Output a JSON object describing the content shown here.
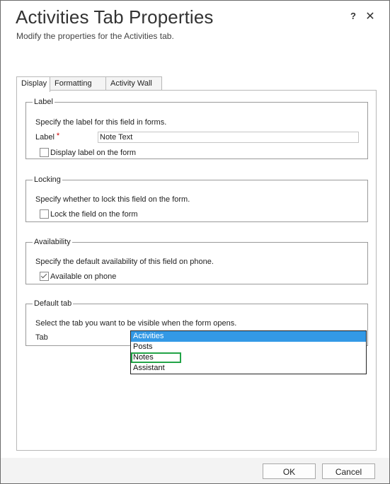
{
  "dialog": {
    "title": "Activities Tab Properties",
    "subtitle": "Modify the properties for the Activities tab.",
    "help_label": "?",
    "close_label": "✕"
  },
  "tabs": [
    {
      "label": "Display",
      "active": true
    },
    {
      "label": "Formatting",
      "active": false
    },
    {
      "label": "Activity Wall",
      "active": false
    }
  ],
  "label_section": {
    "legend": "Label",
    "description": "Specify the label for this field in forms.",
    "field_label": "Label",
    "required_marker": "*",
    "value": "Note Text",
    "checkbox_label": "Display label on the form",
    "checkbox_checked": false
  },
  "locking_section": {
    "legend": "Locking",
    "description": "Specify whether to lock this field on the form.",
    "checkbox_label": "Lock the field on the form",
    "checkbox_checked": false
  },
  "availability_section": {
    "legend": "Availability",
    "description": "Specify the default availability of this field on phone.",
    "checkbox_label": "Available on phone",
    "checkbox_checked": true
  },
  "default_tab_section": {
    "legend": "Default tab",
    "description": "Select the tab you want to be visible when the form opens.",
    "field_label": "Tab",
    "options": [
      "Activities",
      "Posts",
      "Notes",
      "Assistant"
    ],
    "selected": "Activities",
    "highlighted": "Notes"
  },
  "footer": {
    "ok_label": "OK",
    "cancel_label": "Cancel"
  },
  "colors": {
    "selection": "#3399e6",
    "highlight_border": "#22a447",
    "required": "#cc0000"
  }
}
